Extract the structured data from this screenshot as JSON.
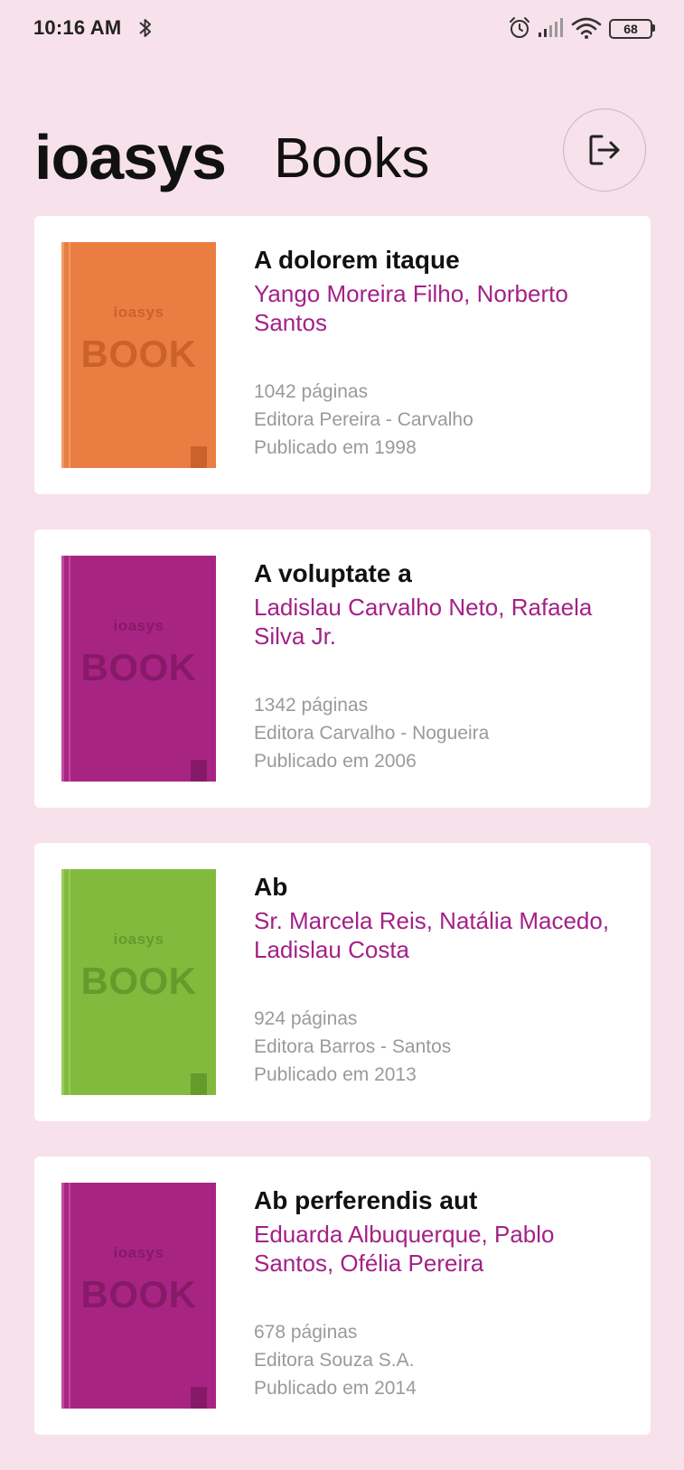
{
  "status_bar": {
    "time": "10:16 AM",
    "battery": "68",
    "icons": [
      "bluetooth-icon",
      "alarm-icon",
      "signal-icon",
      "wifi-icon",
      "battery-icon"
    ]
  },
  "header": {
    "logo": "ioasys",
    "title": "Books",
    "logout_icon": "logout-icon"
  },
  "cover": {
    "brand": "ioasys",
    "word": "BOOK"
  },
  "colors": {
    "background": "#f7e1ea",
    "author_text": "#a32187",
    "meta_text": "#9a9a9a"
  },
  "books": [
    {
      "title": "A dolorem itaque",
      "authors": "Yango Moreira Filho, Norberto Santos",
      "pages": "1042 páginas",
      "publisher": "Editora Pereira - Carvalho",
      "published": "Publicado em 1998",
      "cover_color": "#ea7e42",
      "cover_dark": "#c9622b",
      "cover_spine": "#f09a63"
    },
    {
      "title": "A voluptate a",
      "authors": "Ladislau Carvalho Neto, Rafaela Silva Jr.",
      "pages": "1342 páginas",
      "publisher": "Editora Carvalho - Nogueira",
      "published": "Publicado em 2006",
      "cover_color": "#a82483",
      "cover_dark": "#861a68",
      "cover_spine": "#c04aa0"
    },
    {
      "title": "Ab",
      "authors": "Sr. Marcela Reis, Natália Macedo, Ladislau Costa",
      "pages": "924 páginas",
      "publisher": "Editora Barros - Santos",
      "published": "Publicado em 2013",
      "cover_color": "#82ba3e",
      "cover_dark": "#659b2c",
      "cover_spine": "#9acb5d"
    },
    {
      "title": "Ab perferendis aut",
      "authors": "Eduarda Albuquerque, Pablo Santos, Ofélia Pereira",
      "pages": "678 páginas",
      "publisher": "Editora Souza S.A.",
      "published": "Publicado em 2014",
      "cover_color": "#a82483",
      "cover_dark": "#861a68",
      "cover_spine": "#c04aa0"
    }
  ]
}
